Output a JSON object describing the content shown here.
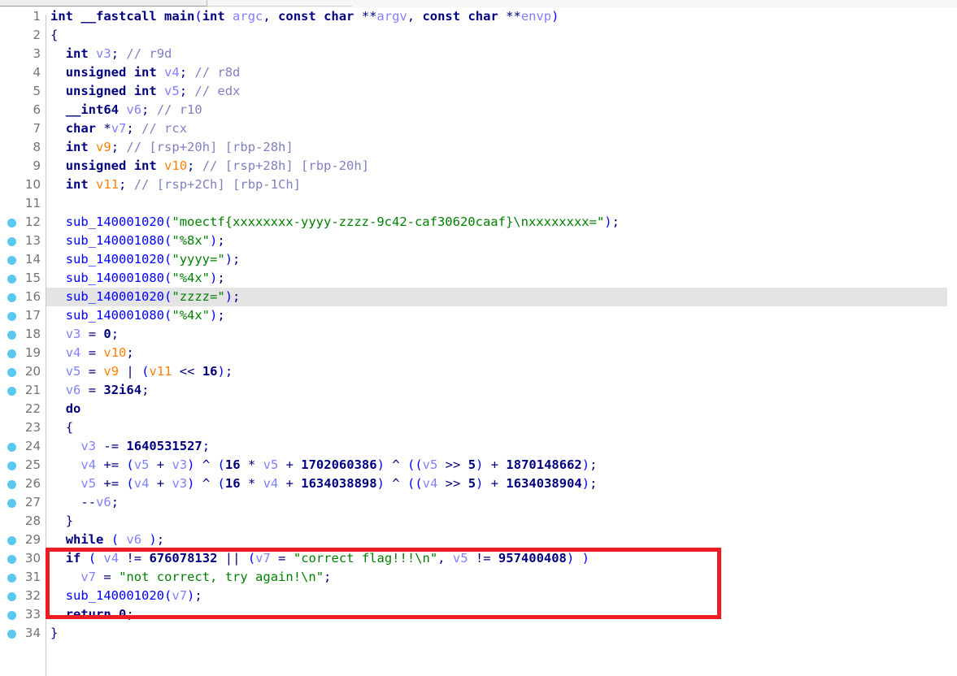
{
  "window": {
    "tab_strip_visible": true
  },
  "editor": {
    "kind": "decompiler-pseudocode-view",
    "highlighted_line": 16,
    "gutter_dot_icon": "breakpoint-dot-icon",
    "colors": {
      "background": "#ffffff",
      "highlight_row": "#e4e4e4",
      "line_number": "#737373",
      "breakpoint_dot": "#5ac8f0",
      "keyword": "#00007f",
      "function": "#0000ff",
      "string": "#008000",
      "comment": "#8080c0",
      "variable": "#8080ff",
      "register_variable": "#ff8000",
      "annotation_box": "#ee1c25"
    },
    "lines": [
      {
        "n": "1",
        "bp": false,
        "text": "int __fastcall main(int argc, const char **argv, const char **envp)"
      },
      {
        "n": "2",
        "bp": false,
        "text": "{"
      },
      {
        "n": "3",
        "bp": false,
        "text": "  int v3; // r9d"
      },
      {
        "n": "4",
        "bp": false,
        "text": "  unsigned int v4; // r8d"
      },
      {
        "n": "5",
        "bp": false,
        "text": "  unsigned int v5; // edx"
      },
      {
        "n": "6",
        "bp": false,
        "text": "  __int64 v6; // r10"
      },
      {
        "n": "7",
        "bp": false,
        "text": "  char *v7; // rcx"
      },
      {
        "n": "8",
        "bp": false,
        "text": "  int v9; // [rsp+20h] [rbp-28h]"
      },
      {
        "n": "9",
        "bp": false,
        "text": "  unsigned int v10; // [rsp+28h] [rbp-20h]"
      },
      {
        "n": "10",
        "bp": false,
        "text": "  int v11; // [rsp+2Ch] [rbp-1Ch]"
      },
      {
        "n": "11",
        "bp": false,
        "text": ""
      },
      {
        "n": "12",
        "bp": true,
        "text": "  sub_140001020(\"moectf{xxxxxxxx-yyyy-zzzz-9c42-caf30620caaf}\\nxxxxxxxx=\");"
      },
      {
        "n": "13",
        "bp": true,
        "text": "  sub_140001080(\"%8x\");"
      },
      {
        "n": "14",
        "bp": true,
        "text": "  sub_140001020(\"yyyy=\");"
      },
      {
        "n": "15",
        "bp": true,
        "text": "  sub_140001080(\"%4x\");"
      },
      {
        "n": "16",
        "bp": true,
        "text": "  sub_140001020(\"zzzz=\");"
      },
      {
        "n": "17",
        "bp": true,
        "text": "  sub_140001080(\"%4x\");"
      },
      {
        "n": "18",
        "bp": true,
        "text": "  v3 = 0;"
      },
      {
        "n": "19",
        "bp": true,
        "text": "  v4 = v10;"
      },
      {
        "n": "20",
        "bp": true,
        "text": "  v5 = v9 | (v11 << 16);"
      },
      {
        "n": "21",
        "bp": true,
        "text": "  v6 = 32i64;"
      },
      {
        "n": "22",
        "bp": false,
        "text": "  do"
      },
      {
        "n": "23",
        "bp": false,
        "text": "  {"
      },
      {
        "n": "24",
        "bp": true,
        "text": "    v3 -= 1640531527;"
      },
      {
        "n": "25",
        "bp": true,
        "text": "    v4 += (v5 + v3) ^ (16 * v5 + 1702060386) ^ ((v5 >> 5) + 1870148662);"
      },
      {
        "n": "26",
        "bp": true,
        "text": "    v5 += (v4 + v3) ^ (16 * v4 + 1634038898) ^ ((v4 >> 5) + 1634038904);"
      },
      {
        "n": "27",
        "bp": true,
        "text": "    --v6;"
      },
      {
        "n": "28",
        "bp": false,
        "text": "  }"
      },
      {
        "n": "29",
        "bp": true,
        "text": "  while ( v6 );"
      },
      {
        "n": "30",
        "bp": true,
        "text": "  if ( v4 != 676078132 || (v7 = \"correct flag!!!\\n\", v5 != 957400408) )"
      },
      {
        "n": "31",
        "bp": true,
        "text": "    v7 = \"not correct, try again!\\n\";"
      },
      {
        "n": "32",
        "bp": true,
        "text": "  sub_140001020(v7);"
      },
      {
        "n": "33",
        "bp": true,
        "text": "  return 0;"
      },
      {
        "n": "34",
        "bp": true,
        "text": "}"
      }
    ]
  },
  "annotation": {
    "name": "red-highlight-box",
    "covers_lines": "30-32",
    "color": "#ee1c25"
  }
}
